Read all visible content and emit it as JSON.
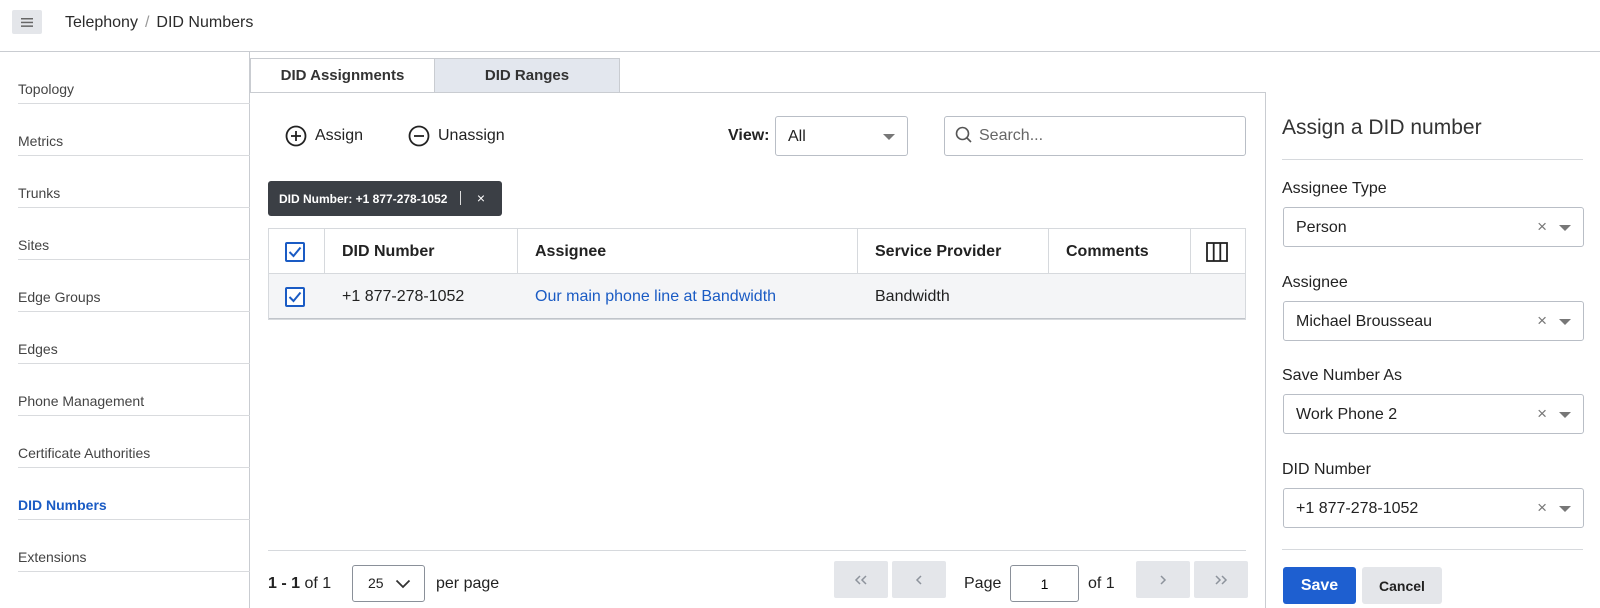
{
  "header": {
    "menu_icon": "hamburger-menu-icon",
    "breadcrumb": [
      "Telephony",
      "DID Numbers"
    ],
    "separator": "/"
  },
  "sidebar": {
    "items": [
      {
        "label": "Topology"
      },
      {
        "label": "Metrics"
      },
      {
        "label": "Trunks"
      },
      {
        "label": "Sites"
      },
      {
        "label": "Edge Groups"
      },
      {
        "label": "Edges"
      },
      {
        "label": "Phone Management"
      },
      {
        "label": "Certificate Authorities"
      },
      {
        "label": "DID Numbers",
        "active": true
      },
      {
        "label": "Extensions"
      }
    ]
  },
  "tabs": [
    {
      "label": "DID Assignments",
      "active": true
    },
    {
      "label": "DID Ranges",
      "active": false
    }
  ],
  "toolbar": {
    "assign_label": "Assign",
    "unassign_label": "Unassign",
    "view_label": "View:",
    "view_value": "All",
    "search_placeholder": "Search..."
  },
  "filter_chip": {
    "label": "DID Number: +1 877-278-1052",
    "close": "×"
  },
  "table": {
    "columns": [
      "DID Number",
      "Assignee",
      "Service Provider",
      "Comments"
    ],
    "rows": [
      {
        "checked": true,
        "did_number": "+1 877-278-1052",
        "assignee": "Our main phone line at Bandwidth",
        "service_provider": "Bandwidth",
        "comments": ""
      }
    ],
    "header_checked": true
  },
  "pagination": {
    "range": "1 - 1",
    "of_total": "of 1",
    "per_page_value": "25",
    "per_page_label": "per page",
    "page_label": "Page",
    "current_page": "1",
    "of_pages": "of 1"
  },
  "assign_panel": {
    "title": "Assign a DID number",
    "fields": [
      {
        "label": "Assignee Type",
        "value": "Person"
      },
      {
        "label": "Assignee",
        "value": "Michael Brousseau"
      },
      {
        "label": "Save Number As",
        "value": "Work Phone 2"
      },
      {
        "label": "DID Number",
        "value": "+1 877-278-1052"
      }
    ],
    "clear_glyph": "×",
    "save_label": "Save",
    "cancel_label": "Cancel"
  },
  "colors": {
    "accent": "#1a5bc4",
    "save_button": "#1e5fd0",
    "chip_bg": "#3b3f45"
  }
}
